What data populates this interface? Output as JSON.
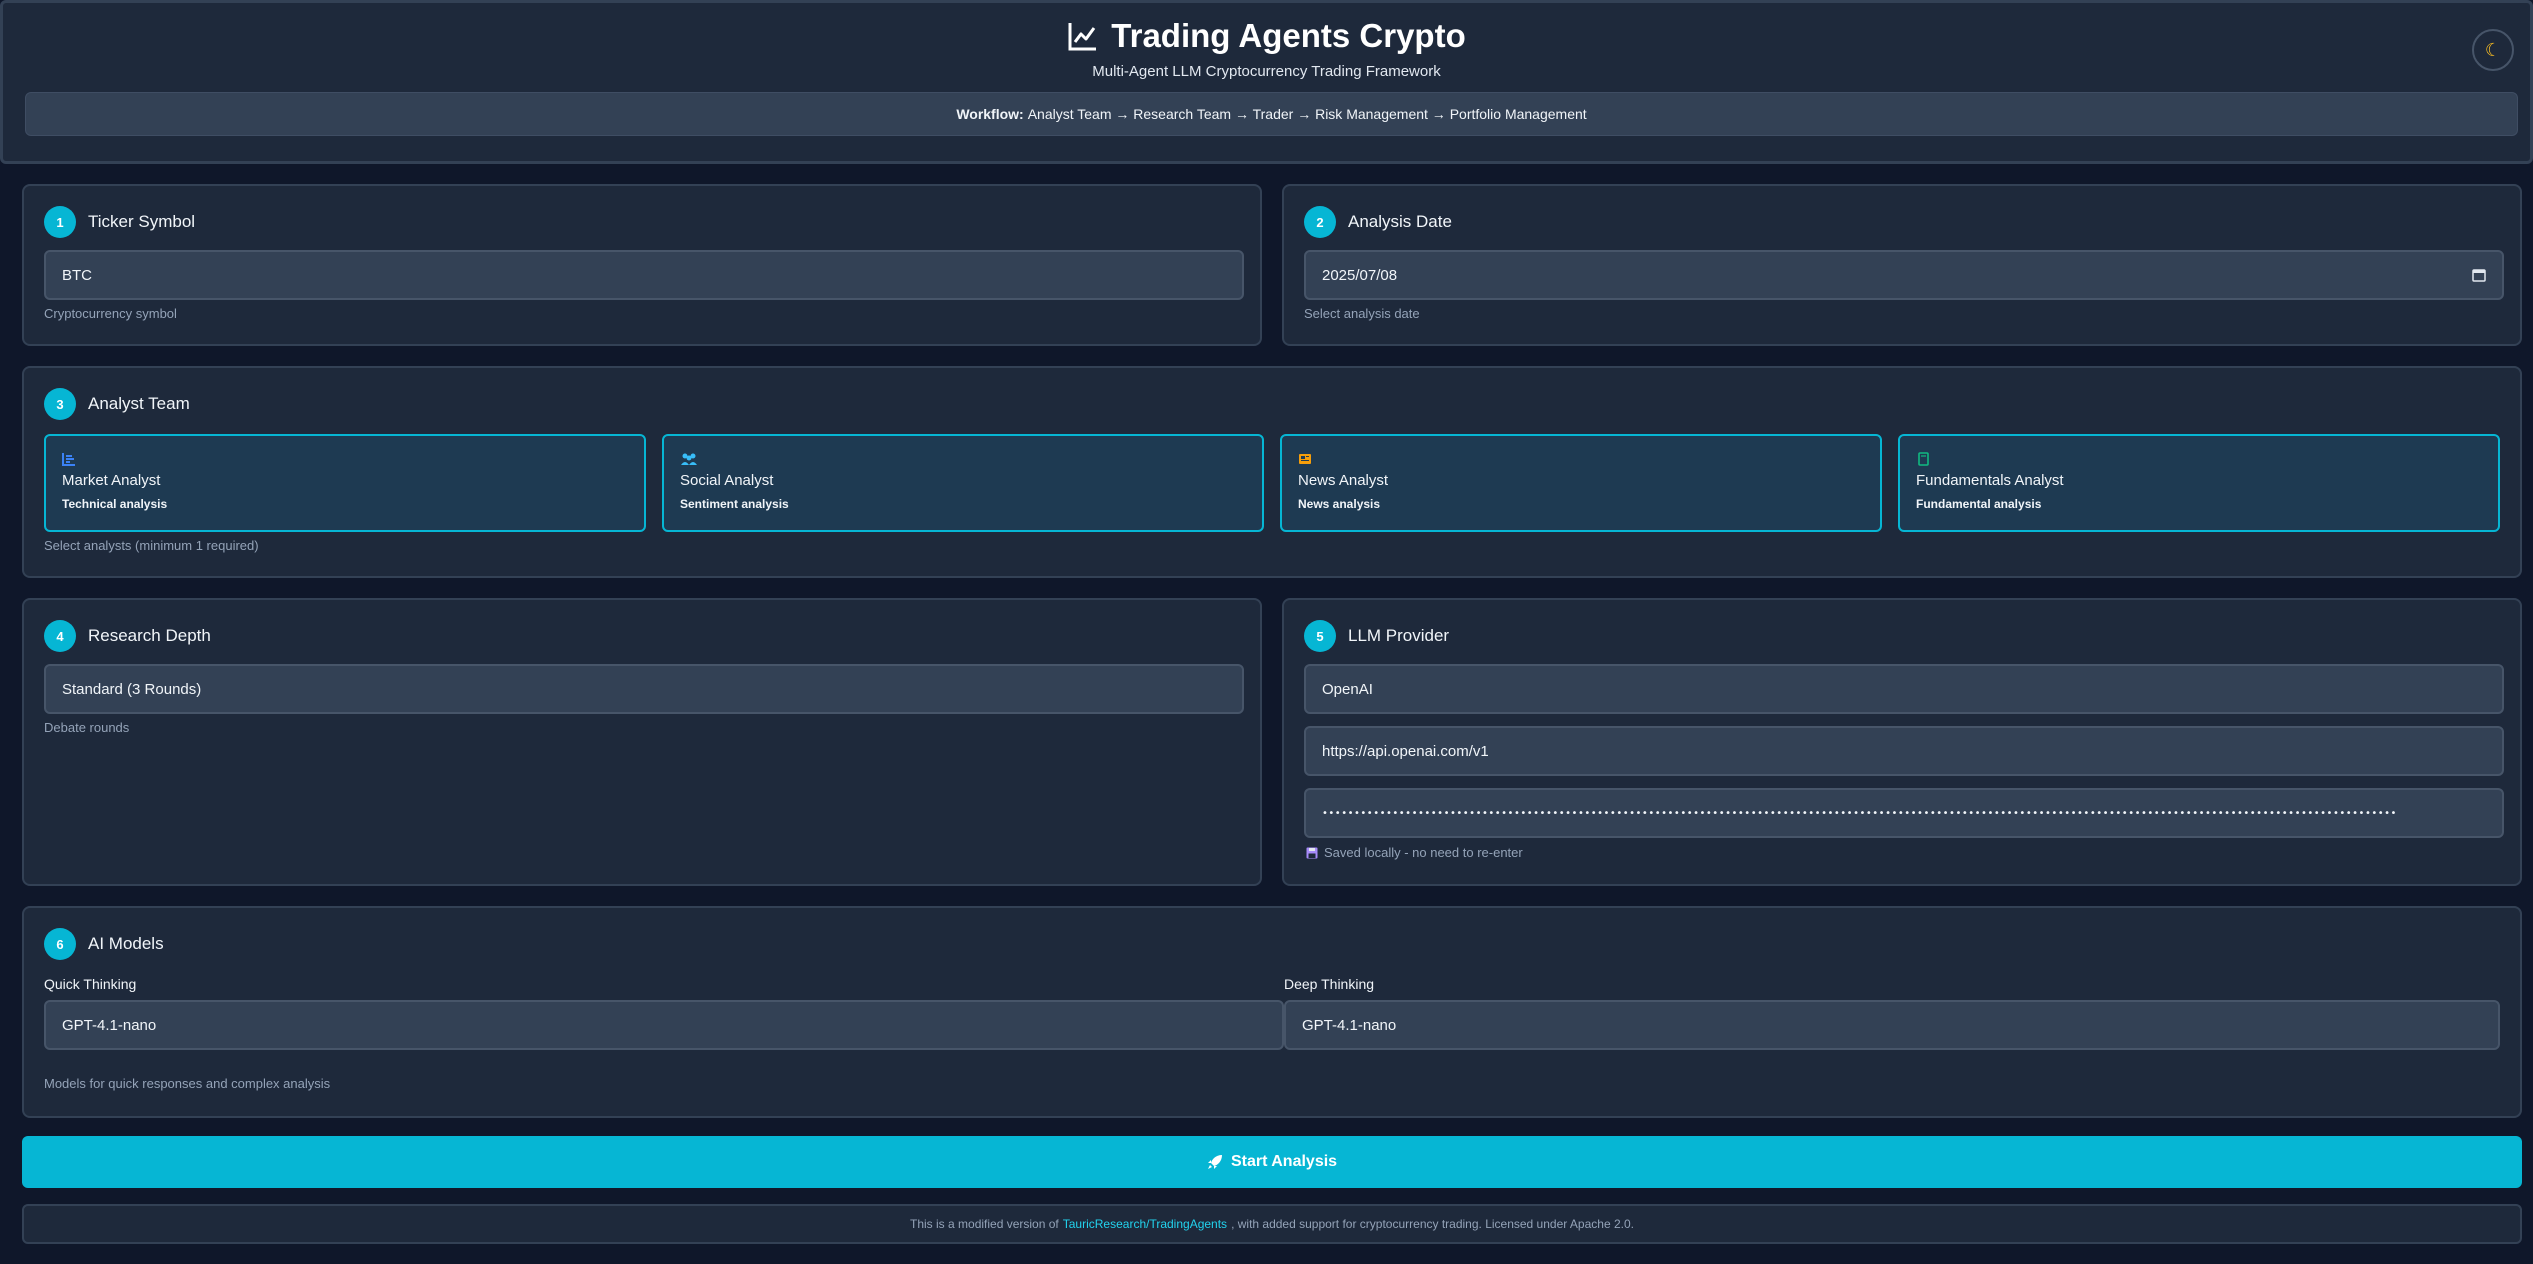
{
  "header": {
    "title": "Trading Agents Crypto",
    "subtitle": "Multi-Agent LLM Cryptocurrency Trading Framework",
    "theme_toggle_icon": "moon-icon",
    "workflow_label": "Workflow:",
    "workflow_steps": "Analyst Team → Research Team → Trader → Risk Management → Portfolio Management"
  },
  "ticker": {
    "step": "1",
    "title": "Ticker Symbol",
    "value": "BTC",
    "hint": "Cryptocurrency symbol"
  },
  "date": {
    "step": "2",
    "title": "Analysis Date",
    "value": "2025/07/08",
    "hint": "Select analysis date"
  },
  "analysts": {
    "step": "3",
    "title": "Analyst Team",
    "items": [
      {
        "name": "Market Analyst",
        "desc": "Technical analysis",
        "icon": "chart-bar-icon",
        "color": "#3b82f6"
      },
      {
        "name": "Social Analyst",
        "desc": "Sentiment analysis",
        "icon": "users-icon",
        "color": "#38bdf8"
      },
      {
        "name": "News Analyst",
        "desc": "News analysis",
        "icon": "newspaper-icon",
        "color": "#f59e0b"
      },
      {
        "name": "Fundamentals Analyst",
        "desc": "Fundamental analysis",
        "icon": "book-icon",
        "color": "#10b981"
      }
    ],
    "hint": "Select analysts (minimum 1 required)"
  },
  "research": {
    "step": "4",
    "title": "Research Depth",
    "value": "Standard (3 Rounds)",
    "hint": "Debate rounds"
  },
  "llm": {
    "step": "5",
    "title": "LLM Provider",
    "provider": "OpenAI",
    "base_url": "https://api.openai.com/v1",
    "api_key_masked": "••••••••••••••••••••••••••••••••••••••••••••••••••••••••••••••••••••••••••••••••••••••••••••••••••••••••••••••••••••••••••••••••••••••••••••••••••••••••••••••••••••••••",
    "saved_note": "Saved locally - no need to re-enter"
  },
  "models": {
    "step": "6",
    "title": "AI Models",
    "quick_label": "Quick Thinking",
    "quick_value": "GPT-4.1-nano",
    "deep_label": "Deep Thinking",
    "deep_value": "GPT-4.1-nano",
    "hint": "Models for quick responses and complex analysis"
  },
  "actions": {
    "start_label": "Start Analysis"
  },
  "footer": {
    "prefix": "This is a modified version of",
    "link": "TauricResearch/TradingAgents",
    "suffix": ", with added support for cryptocurrency trading. Licensed under Apache 2.0."
  },
  "colors": {
    "accent": "#06b6d4",
    "background": "#0f172a",
    "card": "#1e293b"
  }
}
